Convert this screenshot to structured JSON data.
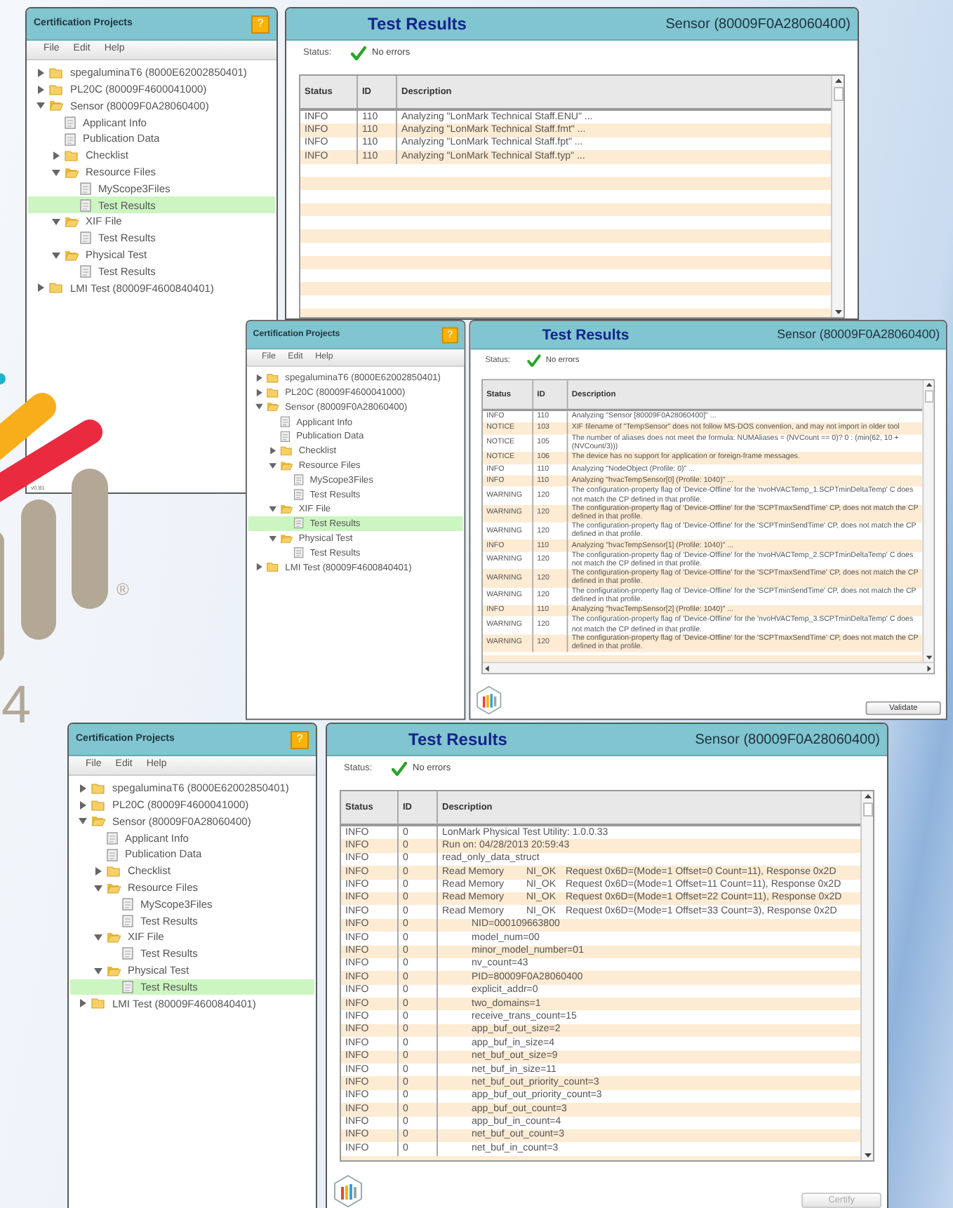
{
  "background_logo": {
    "trademark": "®",
    "text": "4"
  },
  "windows": [
    {
      "sidebar": {
        "title": "Certification Projects",
        "help": "?",
        "menu": [
          "File",
          "Edit",
          "Help"
        ],
        "version": "v0.81",
        "tree": [
          {
            "label": "spegaluminaT6 (8000E62002850401)",
            "kind": "folder",
            "expanded": false,
            "selected": false
          },
          {
            "label": "PL20C (80009F4600041000)",
            "kind": "folder",
            "expanded": false,
            "selected": false
          },
          {
            "label": "Sensor (80009F0A28060400)",
            "kind": "folder",
            "expanded": true,
            "selected": false,
            "children": [
              {
                "label": "Applicant Info",
                "kind": "document",
                "selected": false
              },
              {
                "label": "Publication Data",
                "kind": "document",
                "selected": false
              },
              {
                "label": "Checklist",
                "kind": "folder",
                "expanded": false,
                "selected": false
              },
              {
                "label": "Resource Files",
                "kind": "folder",
                "expanded": true,
                "selected": false,
                "children": [
                  {
                    "label": "MyScope3Files",
                    "kind": "document",
                    "selected": false
                  },
                  {
                    "label": "Test Results",
                    "kind": "document",
                    "selected": true
                  }
                ]
              },
              {
                "label": "XIF File",
                "kind": "folder",
                "expanded": true,
                "selected": false,
                "children": [
                  {
                    "label": "Test Results",
                    "kind": "document",
                    "selected": false
                  }
                ]
              },
              {
                "label": "Physical Test",
                "kind": "folder",
                "expanded": true,
                "selected": false,
                "children": [
                  {
                    "label": "Test Results",
                    "kind": "document",
                    "selected": false
                  }
                ]
              }
            ]
          },
          {
            "label": "LMI Test (80009F4600840401)",
            "kind": "folder",
            "expanded": false,
            "selected": false
          }
        ]
      },
      "panel": {
        "title": "Test Results",
        "device": "Sensor (80009F0A28060400)",
        "status_label": "Status:",
        "status": "No errors",
        "columns": [
          "Status",
          "ID",
          "Description"
        ],
        "rows": [
          {
            "status": "INFO",
            "id": "110",
            "description": [
              "Analyzing \"LonMark Technical Staff.ENU\" ..."
            ]
          },
          {
            "status": "INFO",
            "id": "110",
            "description": [
              "Analyzing \"LonMark Technical Staff.fmt\" ..."
            ]
          },
          {
            "status": "INFO",
            "id": "110",
            "description": [
              "Analyzing \"LonMark Technical Staff.fpt\" ..."
            ]
          },
          {
            "status": "INFO",
            "id": "110",
            "description": [
              "Analyzing \"LonMark Technical Staff.typ\" ..."
            ]
          }
        ]
      }
    },
    {
      "sidebar": {
        "title": "Certification Projects",
        "help": "?",
        "menu": [
          "File",
          "Edit",
          "Help"
        ],
        "tree": [
          {
            "label": "spegaluminaT6 (8000E62002850401)",
            "kind": "folder",
            "expanded": false,
            "selected": false
          },
          {
            "label": "PL20C (80009F4600041000)",
            "kind": "folder",
            "expanded": false,
            "selected": false
          },
          {
            "label": "Sensor (80009F0A28060400)",
            "kind": "folder",
            "expanded": true,
            "selected": false,
            "children": [
              {
                "label": "Applicant Info",
                "kind": "document",
                "selected": false
              },
              {
                "label": "Publication Data",
                "kind": "document",
                "selected": false
              },
              {
                "label": "Checklist",
                "kind": "folder",
                "expanded": false,
                "selected": false
              },
              {
                "label": "Resource Files",
                "kind": "folder",
                "expanded": true,
                "selected": false,
                "children": [
                  {
                    "label": "MyScope3Files",
                    "kind": "document",
                    "selected": false
                  },
                  {
                    "label": "Test Results",
                    "kind": "document",
                    "selected": false
                  }
                ]
              },
              {
                "label": "XIF File",
                "kind": "folder",
                "expanded": true,
                "selected": false,
                "children": [
                  {
                    "label": "Test Results",
                    "kind": "document",
                    "selected": true
                  }
                ]
              },
              {
                "label": "Physical Test",
                "kind": "folder",
                "expanded": true,
                "selected": false,
                "children": [
                  {
                    "label": "Test Results",
                    "kind": "document",
                    "selected": false
                  }
                ]
              }
            ]
          },
          {
            "label": "LMI Test (80009F4600840401)",
            "kind": "folder",
            "expanded": false,
            "selected": false
          }
        ]
      },
      "panel": {
        "title": "Test Results",
        "device": "Sensor (80009F0A28060400)",
        "status_label": "Status:",
        "status": "No errors",
        "columns": [
          "Status",
          "ID",
          "Description"
        ],
        "button": {
          "label": "Validate",
          "disabled": false
        },
        "rows": [
          {
            "status": "INFO",
            "id": "110",
            "description": [
              "Analyzing \"Sensor [80009F0A28060400]\" ..."
            ]
          },
          {
            "status": "NOTICE",
            "id": "103",
            "description": [
              "XIF filename of \"TempSensor\" does not follow MS-DOS convention, and may not import in older tool"
            ]
          },
          {
            "status": "NOTICE",
            "id": "105",
            "description": [
              "The number of aliases does not meet the formula: NUMAliases = (NVCount == 0)? 0 : (min(62, 10 + (NVCount/3)))"
            ]
          },
          {
            "status": "NOTICE",
            "id": "106",
            "description": [
              "The device has no support for application or foreign-frame messages."
            ]
          },
          {
            "status": "INFO",
            "id": "110",
            "description": [
              "Analyzing \"NodeObject (Profile: 0)\" ..."
            ]
          },
          {
            "status": "INFO",
            "id": "110",
            "description": [
              "Analyzing \"hvacTempSensor[0] (Profile: 1040)\" ..."
            ]
          },
          {
            "status": "WARNING",
            "id": "120",
            "description": [
              "The configuration-property flag of 'Device-Offline' for the 'nvoHVACTemp_1.SCPTminDeltaTemp' C does not match the CP defined in that profile."
            ]
          },
          {
            "status": "WARNING",
            "id": "120",
            "description": [
              "The configuration-property flag of 'Device-Offline' for the 'SCPTmaxSendTime' CP, does not match the CP defined in that profile."
            ]
          },
          {
            "status": "WARNING",
            "id": "120",
            "description": [
              "The configuration-property flag of 'Device-Offline' for the 'SCPTminSendTime' CP, does not match the CP defined in that profile."
            ]
          },
          {
            "status": "INFO",
            "id": "110",
            "description": [
              "Analyzing \"hvacTempSensor[1] (Profile: 1040)\" ..."
            ]
          },
          {
            "status": "WARNING",
            "id": "120",
            "description": [
              "The configuration-property flag of 'Device-Offline' for the 'nvoHVACTemp_2.SCPTminDeltaTemp' C does not match the CP defined in that profile."
            ]
          },
          {
            "status": "WARNING",
            "id": "120",
            "description": [
              "The configuration-property flag of 'Device-Offline' for the 'SCPTmaxSendTime' CP, does not match the CP defined in that profile."
            ]
          },
          {
            "status": "WARNING",
            "id": "120",
            "description": [
              "The configuration-property flag of 'Device-Offline' for the 'SCPTminSendTime' CP, does not match the CP defined in that profile."
            ]
          },
          {
            "status": "INFO",
            "id": "110",
            "description": [
              "Analyzing \"hvacTempSensor[2] (Profile: 1040)\" ..."
            ]
          },
          {
            "status": "WARNING",
            "id": "120",
            "description": [
              "The configuration-property flag of 'Device-Offline' for the 'nvoHVACTemp_3.SCPTminDeltaTemp' C does not match the CP defined in that profile."
            ]
          },
          {
            "status": "WARNING",
            "id": "120",
            "description": [
              "The configuration-property flag of 'Device-Offline' for the 'SCPTmaxSendTime' CP, does not match the CP defined in that profile."
            ]
          }
        ]
      }
    },
    {
      "sidebar": {
        "title": "Certification Projects",
        "help": "?",
        "menu": [
          "File",
          "Edit",
          "Help"
        ],
        "tree": [
          {
            "label": "spegaluminaT6 (8000E62002850401)",
            "kind": "folder",
            "expanded": false,
            "selected": false
          },
          {
            "label": "PL20C (80009F4600041000)",
            "kind": "folder",
            "expanded": false,
            "selected": false
          },
          {
            "label": "Sensor (80009F0A28060400)",
            "kind": "folder",
            "expanded": true,
            "selected": false,
            "children": [
              {
                "label": "Applicant Info",
                "kind": "document",
                "selected": false
              },
              {
                "label": "Publication Data",
                "kind": "document",
                "selected": false
              },
              {
                "label": "Checklist",
                "kind": "folder",
                "expanded": false,
                "selected": false
              },
              {
                "label": "Resource Files",
                "kind": "folder",
                "expanded": true,
                "selected": false,
                "children": [
                  {
                    "label": "MyScope3Files",
                    "kind": "document",
                    "selected": false
                  },
                  {
                    "label": "Test Results",
                    "kind": "document",
                    "selected": false
                  }
                ]
              },
              {
                "label": "XIF File",
                "kind": "folder",
                "expanded": true,
                "selected": false,
                "children": [
                  {
                    "label": "Test Results",
                    "kind": "document",
                    "selected": false
                  }
                ]
              },
              {
                "label": "Physical Test",
                "kind": "folder",
                "expanded": true,
                "selected": false,
                "children": [
                  {
                    "label": "Test Results",
                    "kind": "document",
                    "selected": true
                  }
                ]
              }
            ]
          },
          {
            "label": "LMI Test (80009F4600840401)",
            "kind": "folder",
            "expanded": false,
            "selected": false
          }
        ]
      },
      "panel": {
        "title": "Test Results",
        "device": "Sensor (80009F0A28060400)",
        "status_label": "Status:",
        "status": "No errors",
        "columns": [
          "Status",
          "ID",
          "Description"
        ],
        "button": {
          "label": "Certify",
          "disabled": true
        },
        "rows": [
          {
            "status": "INFO",
            "id": "0",
            "indented": false,
            "description": [
              "LonMark Physical Test Utility: 1.0.0.33"
            ]
          },
          {
            "status": "INFO",
            "id": "0",
            "indented": false,
            "description": [
              "Run on: 04/28/2013 20:59:43"
            ]
          },
          {
            "status": "INFO",
            "id": "0",
            "indented": false,
            "description": [
              "read_only_data_struct"
            ]
          },
          {
            "status": "INFO",
            "id": "0",
            "indented": false,
            "description": [
              "Read Memory",
              "NI_OK",
              "Request 0x6D=(Mode=1 Offset=0 Count=11), Response 0x2D"
            ]
          },
          {
            "status": "INFO",
            "id": "0",
            "indented": false,
            "description": [
              "Read Memory",
              "NI_OK",
              "Request 0x6D=(Mode=1 Offset=11 Count=11), Response 0x2D"
            ]
          },
          {
            "status": "INFO",
            "id": "0",
            "indented": false,
            "description": [
              "Read Memory",
              "NI_OK",
              "Request 0x6D=(Mode=1 Offset=22 Count=11), Response 0x2D"
            ]
          },
          {
            "status": "INFO",
            "id": "0",
            "indented": false,
            "description": [
              "Read Memory",
              "NI_OK",
              "Request 0x6D=(Mode=1 Offset=33 Count=3), Response 0x2D"
            ]
          },
          {
            "status": "INFO",
            "id": "0",
            "indented": true,
            "description": [
              "NID=000109663800"
            ]
          },
          {
            "status": "INFO",
            "id": "0",
            "indented": true,
            "description": [
              "model_num=00"
            ]
          },
          {
            "status": "INFO",
            "id": "0",
            "indented": true,
            "description": [
              "minor_model_number=01"
            ]
          },
          {
            "status": "INFO",
            "id": "0",
            "indented": true,
            "description": [
              "nv_count=43"
            ]
          },
          {
            "status": "INFO",
            "id": "0",
            "indented": true,
            "description": [
              "PID=80009F0A28060400"
            ]
          },
          {
            "status": "INFO",
            "id": "0",
            "indented": true,
            "description": [
              "explicit_addr=0"
            ]
          },
          {
            "status": "INFO",
            "id": "0",
            "indented": true,
            "description": [
              "two_domains=1"
            ]
          },
          {
            "status": "INFO",
            "id": "0",
            "indented": true,
            "description": [
              "receive_trans_count=15"
            ]
          },
          {
            "status": "INFO",
            "id": "0",
            "indented": true,
            "description": [
              "app_buf_out_size=2"
            ]
          },
          {
            "status": "INFO",
            "id": "0",
            "indented": true,
            "description": [
              "app_buf_in_size=4"
            ]
          },
          {
            "status": "INFO",
            "id": "0",
            "indented": true,
            "description": [
              "net_buf_out_size=9"
            ]
          },
          {
            "status": "INFO",
            "id": "0",
            "indented": true,
            "description": [
              "net_buf_in_size=11"
            ]
          },
          {
            "status": "INFO",
            "id": "0",
            "indented": true,
            "description": [
              "net_buf_out_priority_count=3"
            ]
          },
          {
            "status": "INFO",
            "id": "0",
            "indented": true,
            "description": [
              "app_buf_out_priority_count=3"
            ]
          },
          {
            "status": "INFO",
            "id": "0",
            "indented": true,
            "description": [
              "app_buf_out_count=3"
            ]
          },
          {
            "status": "INFO",
            "id": "0",
            "indented": true,
            "description": [
              "app_buf_in_count=4"
            ]
          },
          {
            "status": "INFO",
            "id": "0",
            "indented": true,
            "description": [
              "net_buf_out_count=3"
            ]
          },
          {
            "status": "INFO",
            "id": "0",
            "indented": true,
            "description": [
              "net_buf_in_count=3"
            ]
          }
        ]
      }
    }
  ]
}
